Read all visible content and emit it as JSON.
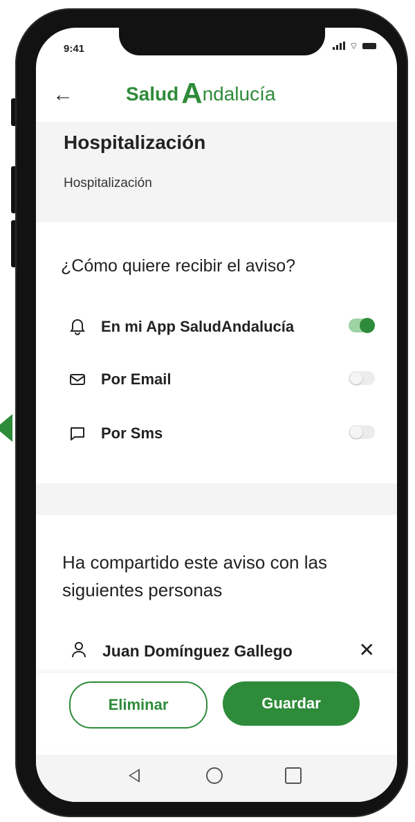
{
  "status_bar": {
    "time": "9:41"
  },
  "header": {
    "logo_salud": "Salud",
    "logo_a": "A",
    "logo_rest": "ndalucía"
  },
  "section": {
    "title": "Hospitalización",
    "subtitle": "Hospitalización"
  },
  "notify": {
    "question": "¿Cómo quiere recibir el aviso?",
    "options": [
      {
        "label": "En mi App SaludAndalucía",
        "icon": "bell-icon",
        "enabled": true
      },
      {
        "label": "Por Email",
        "icon": "mail-icon",
        "enabled": false
      },
      {
        "label": "Por Sms",
        "icon": "message-icon",
        "enabled": false
      }
    ]
  },
  "shared": {
    "title": "Ha compartido este aviso con las siguientes personas",
    "people": [
      {
        "name": "Juan Domínguez Gallego"
      }
    ]
  },
  "actions": {
    "delete_label": "Eliminar",
    "save_label": "Guardar"
  },
  "colors": {
    "brand": "#2e8b3a",
    "band": "#f4f4f4"
  }
}
